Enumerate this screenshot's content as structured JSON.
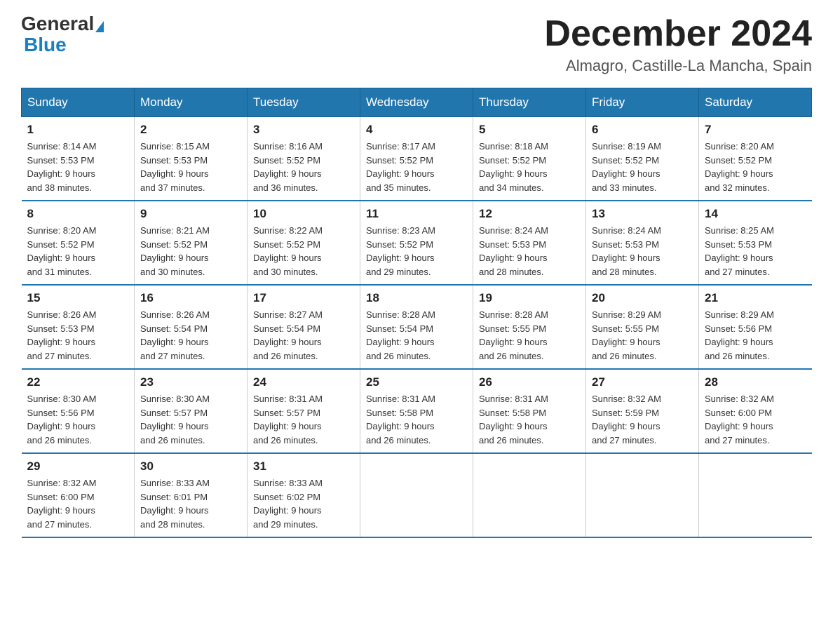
{
  "logo": {
    "general": "General",
    "blue": "Blue"
  },
  "title": "December 2024",
  "location": "Almagro, Castille-La Mancha, Spain",
  "days_of_week": [
    "Sunday",
    "Monday",
    "Tuesday",
    "Wednesday",
    "Thursday",
    "Friday",
    "Saturday"
  ],
  "weeks": [
    [
      {
        "day": "1",
        "sunrise": "8:14 AM",
        "sunset": "5:53 PM",
        "daylight": "9 hours and 38 minutes."
      },
      {
        "day": "2",
        "sunrise": "8:15 AM",
        "sunset": "5:53 PM",
        "daylight": "9 hours and 37 minutes."
      },
      {
        "day": "3",
        "sunrise": "8:16 AM",
        "sunset": "5:52 PM",
        "daylight": "9 hours and 36 minutes."
      },
      {
        "day": "4",
        "sunrise": "8:17 AM",
        "sunset": "5:52 PM",
        "daylight": "9 hours and 35 minutes."
      },
      {
        "day": "5",
        "sunrise": "8:18 AM",
        "sunset": "5:52 PM",
        "daylight": "9 hours and 34 minutes."
      },
      {
        "day": "6",
        "sunrise": "8:19 AM",
        "sunset": "5:52 PM",
        "daylight": "9 hours and 33 minutes."
      },
      {
        "day": "7",
        "sunrise": "8:20 AM",
        "sunset": "5:52 PM",
        "daylight": "9 hours and 32 minutes."
      }
    ],
    [
      {
        "day": "8",
        "sunrise": "8:20 AM",
        "sunset": "5:52 PM",
        "daylight": "9 hours and 31 minutes."
      },
      {
        "day": "9",
        "sunrise": "8:21 AM",
        "sunset": "5:52 PM",
        "daylight": "9 hours and 30 minutes."
      },
      {
        "day": "10",
        "sunrise": "8:22 AM",
        "sunset": "5:52 PM",
        "daylight": "9 hours and 30 minutes."
      },
      {
        "day": "11",
        "sunrise": "8:23 AM",
        "sunset": "5:52 PM",
        "daylight": "9 hours and 29 minutes."
      },
      {
        "day": "12",
        "sunrise": "8:24 AM",
        "sunset": "5:53 PM",
        "daylight": "9 hours and 28 minutes."
      },
      {
        "day": "13",
        "sunrise": "8:24 AM",
        "sunset": "5:53 PM",
        "daylight": "9 hours and 28 minutes."
      },
      {
        "day": "14",
        "sunrise": "8:25 AM",
        "sunset": "5:53 PM",
        "daylight": "9 hours and 27 minutes."
      }
    ],
    [
      {
        "day": "15",
        "sunrise": "8:26 AM",
        "sunset": "5:53 PM",
        "daylight": "9 hours and 27 minutes."
      },
      {
        "day": "16",
        "sunrise": "8:26 AM",
        "sunset": "5:54 PM",
        "daylight": "9 hours and 27 minutes."
      },
      {
        "day": "17",
        "sunrise": "8:27 AM",
        "sunset": "5:54 PM",
        "daylight": "9 hours and 26 minutes."
      },
      {
        "day": "18",
        "sunrise": "8:28 AM",
        "sunset": "5:54 PM",
        "daylight": "9 hours and 26 minutes."
      },
      {
        "day": "19",
        "sunrise": "8:28 AM",
        "sunset": "5:55 PM",
        "daylight": "9 hours and 26 minutes."
      },
      {
        "day": "20",
        "sunrise": "8:29 AM",
        "sunset": "5:55 PM",
        "daylight": "9 hours and 26 minutes."
      },
      {
        "day": "21",
        "sunrise": "8:29 AM",
        "sunset": "5:56 PM",
        "daylight": "9 hours and 26 minutes."
      }
    ],
    [
      {
        "day": "22",
        "sunrise": "8:30 AM",
        "sunset": "5:56 PM",
        "daylight": "9 hours and 26 minutes."
      },
      {
        "day": "23",
        "sunrise": "8:30 AM",
        "sunset": "5:57 PM",
        "daylight": "9 hours and 26 minutes."
      },
      {
        "day": "24",
        "sunrise": "8:31 AM",
        "sunset": "5:57 PM",
        "daylight": "9 hours and 26 minutes."
      },
      {
        "day": "25",
        "sunrise": "8:31 AM",
        "sunset": "5:58 PM",
        "daylight": "9 hours and 26 minutes."
      },
      {
        "day": "26",
        "sunrise": "8:31 AM",
        "sunset": "5:58 PM",
        "daylight": "9 hours and 26 minutes."
      },
      {
        "day": "27",
        "sunrise": "8:32 AM",
        "sunset": "5:59 PM",
        "daylight": "9 hours and 27 minutes."
      },
      {
        "day": "28",
        "sunrise": "8:32 AM",
        "sunset": "6:00 PM",
        "daylight": "9 hours and 27 minutes."
      }
    ],
    [
      {
        "day": "29",
        "sunrise": "8:32 AM",
        "sunset": "6:00 PM",
        "daylight": "9 hours and 27 minutes."
      },
      {
        "day": "30",
        "sunrise": "8:33 AM",
        "sunset": "6:01 PM",
        "daylight": "9 hours and 28 minutes."
      },
      {
        "day": "31",
        "sunrise": "8:33 AM",
        "sunset": "6:02 PM",
        "daylight": "9 hours and 29 minutes."
      },
      null,
      null,
      null,
      null
    ]
  ],
  "labels": {
    "sunrise": "Sunrise:",
    "sunset": "Sunset:",
    "daylight": "Daylight:"
  }
}
